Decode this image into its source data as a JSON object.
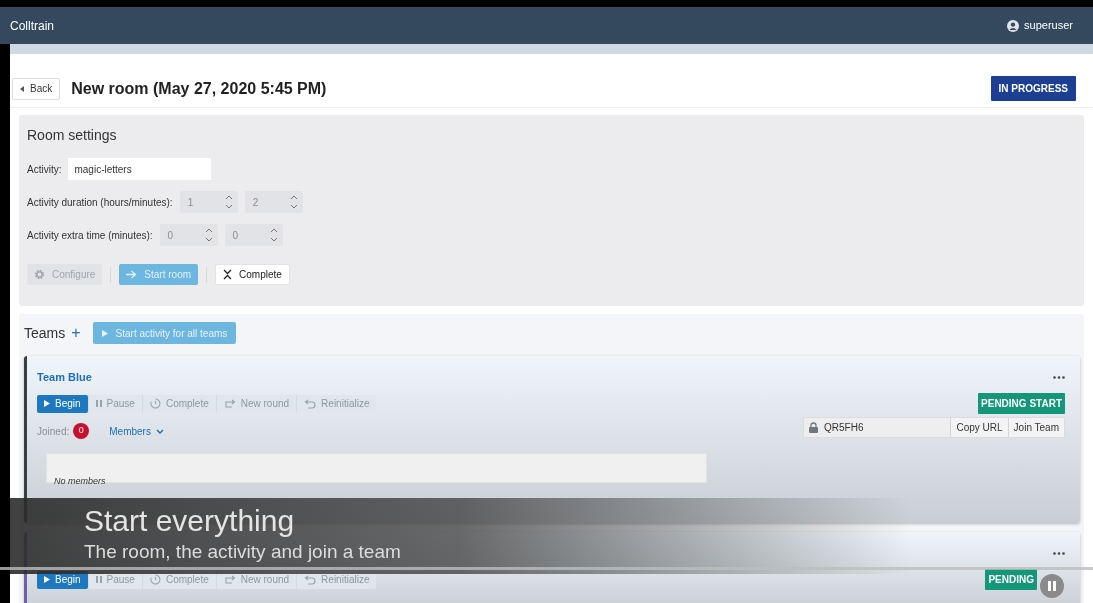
{
  "nav": {
    "brand": "Colltrain",
    "user": "superuser"
  },
  "header": {
    "back": "Back",
    "title": "New room (May 27, 2020 5:45 PM)",
    "status": "IN PROGRESS"
  },
  "room_settings": {
    "title": "Room settings",
    "activity_label": "Activity:",
    "activity_value": "magic-letters",
    "duration_label": "Activity duration (hours/minutes):",
    "duration": [
      "1",
      "2"
    ],
    "extra_label": "Activity extra time (minutes):",
    "extra": [
      "0",
      "0"
    ],
    "buttons": [
      {
        "label": "Configure",
        "kind": "configure",
        "disabled": true
      },
      {
        "label": "Start room",
        "kind": "start",
        "disabled": true
      },
      {
        "label": "Complete",
        "kind": "complete",
        "disabled": false
      }
    ]
  },
  "teams": {
    "title": "Teams",
    "add": "+",
    "start_all": "Start activity for all teams",
    "items": [
      {
        "name": "Team Blue",
        "color": "#3a3d42",
        "status": "PENDING START",
        "joined_label": "Joined:",
        "joined_count": "0",
        "members": "Members",
        "code": "QR5FH6",
        "copy": "Copy URL",
        "join": "Join Team",
        "empty": "No members",
        "actions": [
          {
            "label": "Begin",
            "kind": "begin",
            "disabled": false
          },
          {
            "label": "Pause",
            "kind": "pause",
            "disabled": true
          },
          {
            "label": "Complete",
            "kind": "complete",
            "disabled": true
          },
          {
            "label": "New round",
            "kind": "new_round",
            "disabled": true
          },
          {
            "label": "Reinitialize",
            "kind": "reinitialize",
            "disabled": true
          }
        ]
      },
      {
        "color": "#6d5fa8",
        "status": "PENDING",
        "actions": [
          {
            "label": "Begin",
            "kind": "begin",
            "disabled": false
          },
          {
            "label": "Pause",
            "kind": "pause",
            "disabled": true
          },
          {
            "label": "Complete",
            "kind": "complete",
            "disabled": true
          },
          {
            "label": "New round",
            "kind": "new_round",
            "disabled": true
          },
          {
            "label": "Reinitialize",
            "kind": "reinitialize",
            "disabled": true
          }
        ]
      }
    ]
  },
  "caption": {
    "title": "Start everything",
    "subtitle": "The room, the activity and join a team"
  }
}
